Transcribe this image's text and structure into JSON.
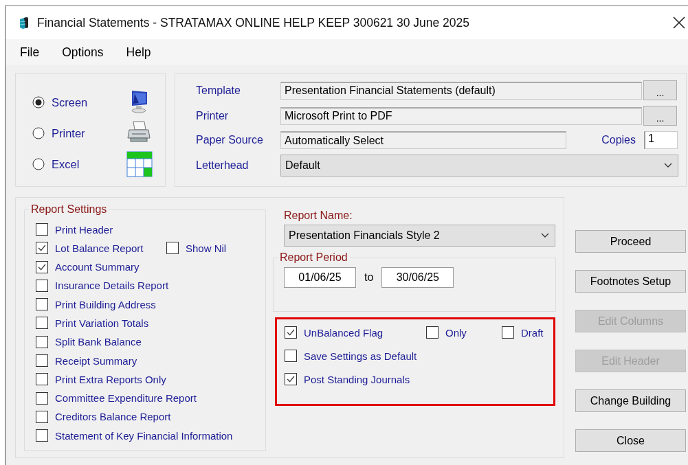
{
  "window": {
    "title": "Financial Statements - STRATAMAX ONLINE HELP KEEP 300621 30 June 2025"
  },
  "menu": [
    "File",
    "Options",
    "Help"
  ],
  "output": [
    {
      "label": "Screen",
      "selected": true,
      "kind": "screen"
    },
    {
      "label": "Printer",
      "selected": false,
      "kind": "printer"
    },
    {
      "label": "Excel",
      "selected": false,
      "kind": "excel"
    }
  ],
  "print_settings": {
    "template": {
      "label": "Template",
      "value": "Presentation Financial Statements (default)",
      "button": "..."
    },
    "printer": {
      "label": "Printer",
      "value": "Microsoft Print to PDF",
      "button": "..."
    },
    "paper_source": {
      "label": "Paper Source",
      "value": "Automatically Select"
    },
    "copies": {
      "label": "Copies",
      "value": "1"
    },
    "letterhead": {
      "label": "Letterhead",
      "value": "Default"
    }
  },
  "report_settings": {
    "title": "Report Settings",
    "items": [
      {
        "label": "Print Header",
        "checked": false
      },
      {
        "label": "Lot Balance Report",
        "checked": true,
        "side": {
          "label": "Show Nil",
          "checked": false
        }
      },
      {
        "label": "Account Summary",
        "checked": true
      },
      {
        "label": "Insurance Details Report",
        "checked": false
      },
      {
        "label": "Print Building Address",
        "checked": false
      },
      {
        "label": "Print Variation Totals",
        "checked": false
      },
      {
        "label": "Split Bank Balance",
        "checked": false
      },
      {
        "label": "Receipt Summary",
        "checked": false
      },
      {
        "label": "Print Extra Reports Only",
        "checked": false
      },
      {
        "label": "Committee Expenditure Report",
        "checked": false
      },
      {
        "label": "Creditors Balance Report",
        "checked": false
      },
      {
        "label": "Statement of Key Financial Information",
        "checked": false
      }
    ]
  },
  "report_name": {
    "label": "Report Name:",
    "value": "Presentation Financials Style 2"
  },
  "report_period": {
    "title": "Report Period",
    "from": "01/06/25",
    "separator": "to",
    "to": "30/06/25"
  },
  "options": [
    [
      {
        "label": "UnBalanced Flag",
        "checked": true
      },
      {
        "label": "Only",
        "checked": false
      },
      {
        "label": "Draft",
        "checked": false
      }
    ],
    [
      {
        "label": "Save Settings as Default",
        "checked": false
      }
    ],
    [
      {
        "label": "Post Standing Journals",
        "checked": true
      }
    ]
  ],
  "buttons": [
    {
      "label": "Proceed",
      "disabled": false
    },
    {
      "label": "Footnotes Setup",
      "disabled": false
    },
    {
      "label": "Edit Columns",
      "disabled": true
    },
    {
      "label": "Edit Header",
      "disabled": true
    },
    {
      "label": "Change Building",
      "disabled": false
    },
    {
      "label": "Close",
      "disabled": false
    }
  ]
}
